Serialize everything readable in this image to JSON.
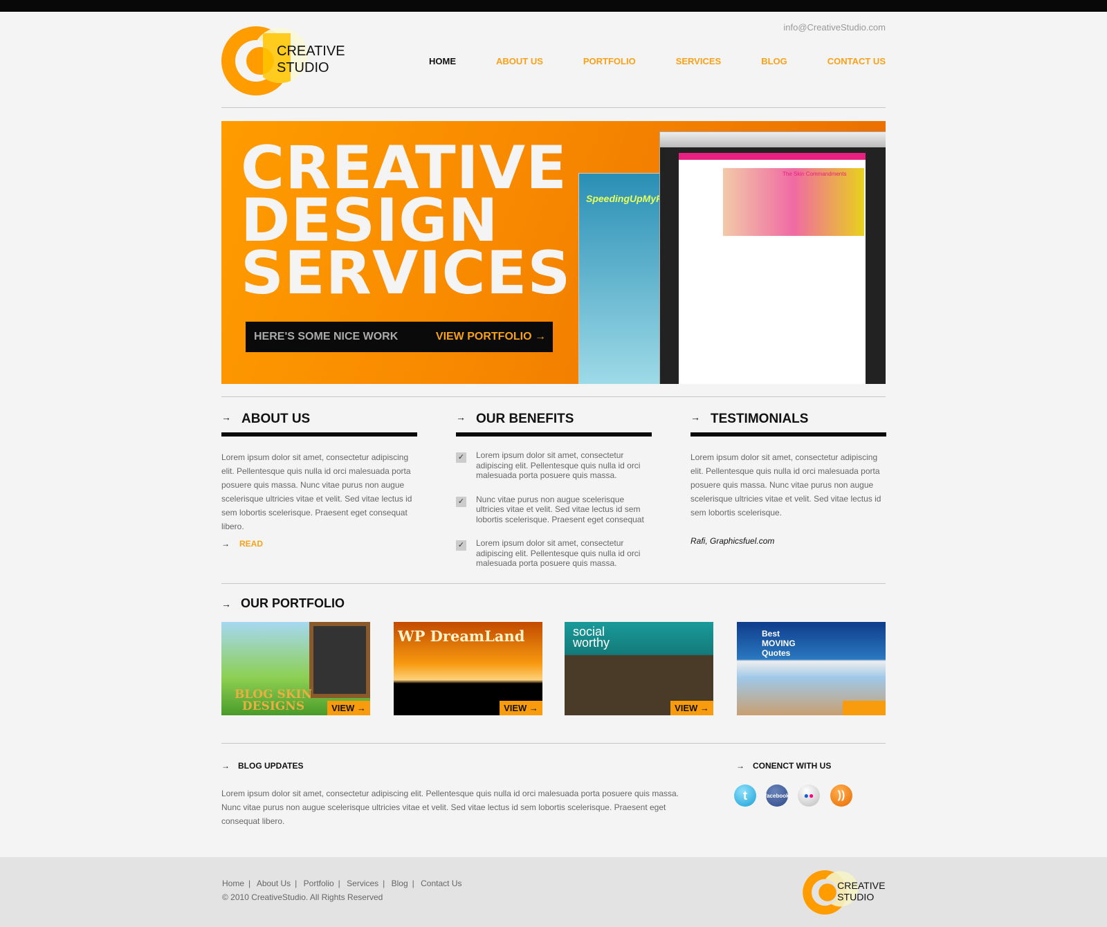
{
  "header": {
    "email": "info@CreativeStudio.com",
    "logo": {
      "line1": "CREATIVE",
      "line2": "STUDIO"
    },
    "nav": [
      {
        "label": "HOME",
        "active": true
      },
      {
        "label": "ABOUT US"
      },
      {
        "label": "PORTFOLIO"
      },
      {
        "label": "SERVICES"
      },
      {
        "label": "BLOG"
      },
      {
        "label": "CONTACT US"
      }
    ]
  },
  "hero": {
    "title_lines": [
      "CREATIVE",
      "DESIGN",
      "SERVICES"
    ],
    "cta_text": "HERE'S SOME NICE WORK",
    "cta_link": "VIEW PORTFOLIO →",
    "shot1_title": "SpeedingUpMyPC",
    "shot2_text": "The Skin Commandments"
  },
  "about": {
    "title": "ABOUT US",
    "text": "Lorem ipsum dolor sit amet, consectetur adipiscing elit. Pellentesque quis nulla id orci malesuada porta posuere quis massa. Nunc vitae purus non augue scelerisque ultricies vitae et velit. Sed vitae lectus id sem lobortis scelerisque. Praesent eget consequat libero.",
    "read": "READ"
  },
  "benefits": {
    "title": "OUR BENEFITS",
    "items": [
      "Lorem ipsum dolor sit amet, consectetur adipiscing elit. Pellentesque quis nulla id orci malesuada porta posuere quis massa.",
      "Nunc vitae purus non augue scelerisque ultricies vitae et velit. Sed vitae lectus id sem lobortis scelerisque. Praesent eget consequat",
      "Lorem ipsum dolor sit amet, consectetur adipiscing elit. Pellentesque quis nulla id orci malesuada porta posuere quis massa."
    ]
  },
  "testimonials": {
    "title": "TESTIMONIALS",
    "text": "Lorem ipsum dolor sit amet, consectetur adipiscing elit. Pellentesque quis nulla id orci malesuada porta posuere quis massa. Nunc vitae purus non augue scelerisque ultricies vitae et velit. Sed vitae lectus id sem lobortis scelerisque.",
    "author": "Rafi, Graphicsfuel.com"
  },
  "portfolio": {
    "title": "OUR PORTFOLIO",
    "view_label": "VIEW →",
    "items": [
      {
        "caption": "BLOG SKIN DESIGNS"
      },
      {
        "caption": "WP DreamLand"
      },
      {
        "caption": "social worthy"
      },
      {
        "caption": "Best MOVING Quotes"
      }
    ]
  },
  "blog": {
    "title": "BLOG UPDATES",
    "text": "Lorem ipsum dolor sit amet, consectetur adipiscing elit. Pellentesque quis nulla id orci malesuada porta posuere quis massa. Nunc vitae purus non augue scelerisque ultricies vitae et velit. Sed vitae lectus id sem lobortis scelerisque. Praesent eget consequat libero."
  },
  "connect": {
    "title": "CONENCT WITH US",
    "icons": [
      "twitter-icon",
      "facebook-icon",
      "flickr-icon",
      "rss-icon"
    ],
    "facebook_label": "facebook"
  },
  "footer": {
    "links": [
      "Home",
      "About Us",
      "Portfolio",
      "Services",
      "Blog",
      "Contact Us"
    ],
    "copyright": "© 2010 CreativeStudio. All Rights Reserved"
  },
  "colors": {
    "accent": "#f7a11a",
    "dark": "#0a0a0a",
    "background": "#f4f4f4",
    "footer": "#e3e3e3"
  }
}
